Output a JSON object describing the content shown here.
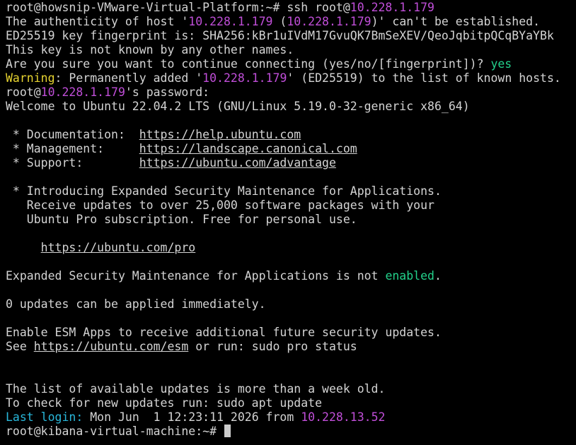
{
  "terminal": {
    "colors": {
      "background": "#000000",
      "foreground": "#d4d4d4",
      "ip": "#c04ed8",
      "warning": "#e6d330",
      "accent_green": "#23d18b",
      "last_login": "#29b8db"
    },
    "l1": "root@howsnip-VMware-Virtual-Platform:~# ssh root@",
    "l1_ip": "10.228.1.179",
    "l2_a": "The authenticity of host '",
    "l2_ip1": "10.228.1.179",
    "l2_b": " (",
    "l2_ip2": "10.228.1.179",
    "l2_c": ")' can't be established.",
    "l3": "ED25519 key fingerprint is: SHA256:kBr1uIVdM17GvuQK7BmSeXEV/QeoJqbitpQCqBYaYBk",
    "l4": "This key is not known by any other names.",
    "l5": "Are you sure you want to continue connecting (yes/no/[fingerprint])? ",
    "l5_answer": "yes",
    "l6_warn": "Warning",
    "l6_a": ": Permanently added '",
    "l6_ip": "10.228.1.179",
    "l6_b": "' (ED25519) to the list of known hosts.",
    "l7_a": "root@",
    "l7_ip": "10.228.1.179",
    "l7_b": "'s password:",
    "l8": "Welcome to Ubuntu 22.04.2 LTS (GNU/Linux 5.19.0-32-generic x86_64)",
    "l10_label": " * Documentation:  ",
    "l10_link": "https://help.ubuntu.com",
    "l11_label": " * Management:     ",
    "l11_link": "https://landscape.canonical.com",
    "l12_label": " * Support:        ",
    "l12_link": "https://ubuntu.com/advantage",
    "l14": " * Introducing Expanded Security Maintenance for Applications.",
    "l15": "   Receive updates to over 25,000 software packages with your",
    "l16": "   Ubuntu Pro subscription. Free for personal use.",
    "l18_indent": "     ",
    "l18_link": "https://ubuntu.com/pro",
    "l20_a": "Expanded Security Maintenance for Applications is not ",
    "l20_enabled": "enabled",
    "l20_b": ".",
    "l22": "0 updates can be applied immediately.",
    "l24": "Enable ESM Apps to receive additional future security updates.",
    "l25_a": "See ",
    "l25_link": "https://ubuntu.com/esm",
    "l25_b": " or run: sudo pro status",
    "l28": "The list of available updates is more than a week old.",
    "l29": "To check for new updates run: sudo apt update",
    "l30_label": "Last login:",
    "l30_a": " Mon Jun  1 12:23:11 2026 from ",
    "l30_ip": "10.228.13.52",
    "l31_prompt": "root@kibana-virtual-machine:~# "
  }
}
